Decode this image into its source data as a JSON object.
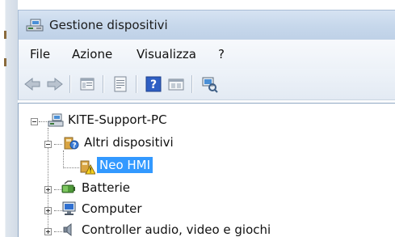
{
  "window": {
    "title": "Gestione dispositivi",
    "title_icon": "device-manager-icon"
  },
  "menu": {
    "items": [
      "File",
      "Azione",
      "Visualizza",
      "?"
    ]
  },
  "toolbar": {
    "buttons": [
      {
        "name": "back-arrow-icon"
      },
      {
        "name": "forward-arrow-icon"
      },
      {
        "name": "properties-window-icon"
      },
      {
        "name": "device-list-icon"
      },
      {
        "name": "help-icon"
      },
      {
        "name": "driver-details-icon"
      },
      {
        "name": "scan-hardware-icon"
      }
    ]
  },
  "tree": {
    "root": {
      "label": "KITE-Support-PC",
      "icon": "computer-root-icon",
      "expanded": true
    },
    "nodes": [
      {
        "label": "Altri dispositivi",
        "icon": "unknown-device-icon",
        "expanded": true,
        "level": 1
      },
      {
        "label": "Neo HMI",
        "icon": "warning-device-icon",
        "selected": true,
        "level": 2
      },
      {
        "label": "Batterie",
        "icon": "battery-icon",
        "expanded": false,
        "level": 1
      },
      {
        "label": "Computer",
        "icon": "monitor-icon",
        "expanded": false,
        "level": 1
      },
      {
        "label": "Controller audio, video e giochi",
        "icon": "speaker-icon",
        "expanded": false,
        "level": 1
      }
    ]
  },
  "colors": {
    "selection": "#3399ff",
    "titlebar": "#c6d7eb"
  }
}
